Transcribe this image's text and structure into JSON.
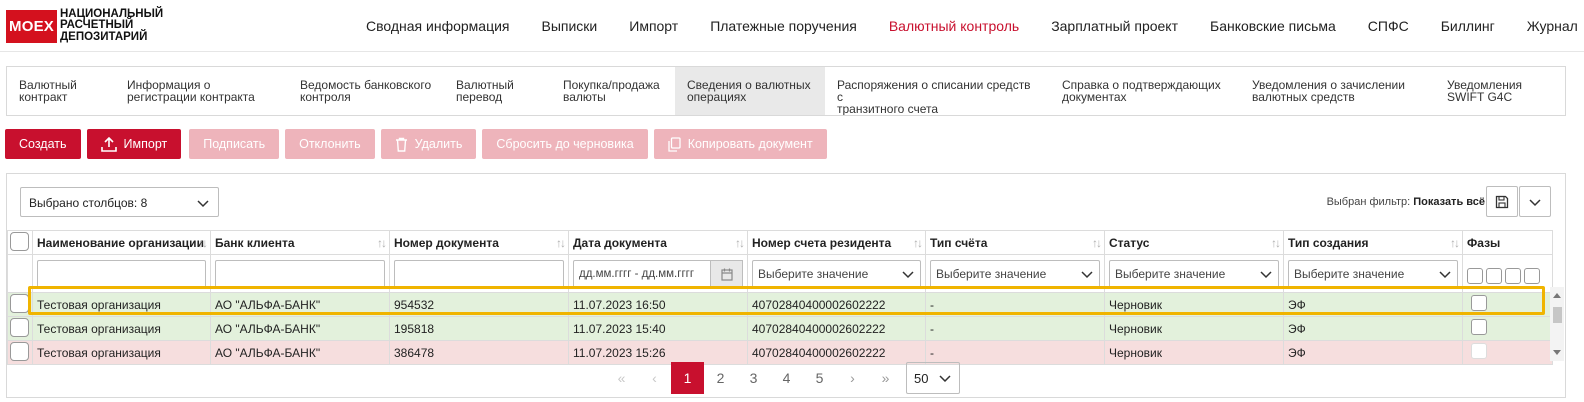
{
  "logo": {
    "badge": "MOEX",
    "line1": "НАЦИОНАЛЬНЫЙ",
    "line2": "РАСЧЕТНЫЙ",
    "line3": "ДЕПОЗИТАРИЙ"
  },
  "nav": [
    {
      "label": "Сводная информация"
    },
    {
      "label": "Выписки"
    },
    {
      "label": "Импорт"
    },
    {
      "label": "Платежные поручения"
    },
    {
      "label": "Валютный контроль",
      "active": true
    },
    {
      "label": "Зарплатный проект"
    },
    {
      "label": "Банковские письма"
    },
    {
      "label": "СПФС"
    },
    {
      "label": "Биллинг"
    },
    {
      "label": "Журнал"
    }
  ],
  "subtabs": [
    {
      "line1": "Валютный",
      "line2": "контракт"
    },
    {
      "line1": "Информация о",
      "line2": "регистрации контракта"
    },
    {
      "line1": "Ведомость банковского",
      "line2": "контроля"
    },
    {
      "line1": "Валютный",
      "line2": "перевод"
    },
    {
      "line1": "Покупка/продажа",
      "line2": "валюты"
    },
    {
      "line1": "Сведения о валютных",
      "line2": "операциях",
      "active": true
    },
    {
      "line1": "Распоряжения о списании средств с",
      "line2": "транзитного счета"
    },
    {
      "line1": "Справка о подтверждающих",
      "line2": "документах"
    },
    {
      "line1": "Уведомления о зачислении",
      "line2": "валютных средств"
    },
    {
      "line1": "Уведомления",
      "line2": "SWIFT G4C"
    }
  ],
  "toolbar": {
    "create": "Создать",
    "import": "Импорт",
    "sign": "Подписать",
    "reject": "Отклонить",
    "delete": "Удалить",
    "reset_draft": "Сбросить до черновика",
    "copy_doc": "Копировать документ"
  },
  "grid": {
    "columns_selected": "Выбрано столбцов: 8",
    "filter_label": "Выбран фильтр:",
    "filter_value": "Показать всё",
    "headers": {
      "org": "Наименование организации",
      "bank": "Банк клиента",
      "docnum": "Номер документа",
      "docdate": "Дата документа",
      "account": "Номер счета резидента",
      "acctype": "Тип счёта",
      "status": "Статус",
      "createtype": "Тип создания",
      "phases": "Фазы"
    },
    "filters": {
      "date_placeholder": "дд.мм.гггг - дд.мм.гггг",
      "select_placeholder": "Выберите значение"
    },
    "rows": [
      {
        "org": "Тестовая организация",
        "bank": "АО \"АЛЬФА-БАНК\"",
        "docnum": "954532",
        "docdate": "11.07.2023 16:50",
        "account": "40702840400002602222",
        "acctype": "-",
        "status": "Черновик",
        "createtype": "ЭФ",
        "color": "#e3f1dc"
      },
      {
        "org": "Тестовая организация",
        "bank": "АО \"АЛЬФА-БАНК\"",
        "docnum": "195818",
        "docdate": "11.07.2023 15:40",
        "account": "40702840400002602222",
        "acctype": "-",
        "status": "Черновик",
        "createtype": "ЭФ",
        "color": "#e3f1dc"
      },
      {
        "org": "Тестовая организация",
        "bank": "АО \"АЛЬФА-БАНК\"",
        "docnum": "386478",
        "docdate": "11.07.2023 15:26",
        "account": "40702840400002602222",
        "acctype": "-",
        "status": "Черновик",
        "createtype": "ЭФ",
        "color": "#f6dede"
      }
    ]
  },
  "pagination": {
    "first": "«",
    "prev": "‹",
    "pages": [
      "1",
      "2",
      "3",
      "4",
      "5"
    ],
    "current": "1",
    "next": "›",
    "last": "»",
    "page_size": "50"
  }
}
